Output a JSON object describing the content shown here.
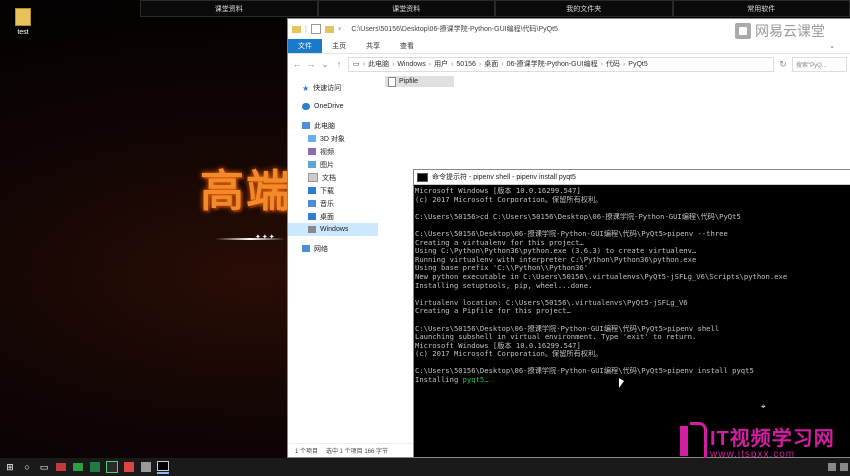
{
  "desktop": {
    "topbar": [
      "课堂资料",
      "课堂资料",
      "我的文件夹",
      "常用软件"
    ],
    "icon_label": "test",
    "bg_text": "高端",
    "bg_stars": "✦✦✦"
  },
  "explorer": {
    "title_path": "C:\\Users\\50156\\Desktop\\06-撩课学院-Python-GUI编程\\代码\\PyQt5",
    "logo_text": "网易云课堂",
    "ribbon_tabs": [
      "文件",
      "主页",
      "共享",
      "查看"
    ],
    "address_crumbs": [
      "此电脑",
      "Windows",
      "用户",
      "50156",
      "桌面",
      "06-撩课学院-Python-GUI编程",
      "代码",
      "PyQt5"
    ],
    "search_placeholder": "搜索\"PyQ...",
    "nav_items": [
      {
        "label": "快速访问",
        "icon": "star-icon"
      },
      {
        "label": "OneDrive",
        "icon": "cloud-icon"
      },
      {
        "label": "此电脑",
        "icon": "pc-icon"
      },
      {
        "label": "3D 对象",
        "icon": "cube-icon"
      },
      {
        "label": "视频",
        "icon": "video-icon"
      },
      {
        "label": "图片",
        "icon": "picture-icon"
      },
      {
        "label": "文档",
        "icon": "document-icon"
      },
      {
        "label": "下载",
        "icon": "download-icon"
      },
      {
        "label": "音乐",
        "icon": "music-icon"
      },
      {
        "label": "桌面",
        "icon": "desktop-icon"
      },
      {
        "label": "Windows",
        "icon": "drive-icon"
      },
      {
        "label": "网络",
        "icon": "network-icon"
      }
    ],
    "file_name": "Pipfile",
    "status_count": "1 个项目",
    "status_selected": "选中 1 个项目  166 字节"
  },
  "terminal": {
    "title": "命令提示符 - pipenv  shell - pipenv  install pyqt5",
    "lines": [
      {
        "t": "Microsoft Windows [版本 10.0.16299.547]",
        "h": ""
      },
      {
        "t": "(c) 2017 Microsoft Corporation。保留所有权利。",
        "h": ""
      },
      {
        "t": "",
        "h": ""
      },
      {
        "t": "C:\\Users\\50156>cd C:\\Users\\50156\\Desktop\\06-撩课学院-Python-GUI编程\\代码\\PyQt5",
        "h": ""
      },
      {
        "t": "",
        "h": ""
      },
      {
        "t": "C:\\Users\\50156\\Desktop\\06-撩课学院-Python-GUI编程\\代码\\PyQt5>pipenv --three",
        "h": ""
      },
      {
        "t": "Creating a virtualenv for this project…",
        "h": ""
      },
      {
        "t": "Using C:\\Python\\Python36\\python.exe (3.6.3) to create virtualenv…",
        "h": ""
      },
      {
        "t": "Running virtualenv with interpreter C:\\Python\\Python36\\python.exe",
        "h": ""
      },
      {
        "t": "Using base prefix 'C:\\\\Python\\\\Python36'",
        "h": ""
      },
      {
        "t": "New python executable in C:\\Users\\50156\\.virtualenvs\\PyQt5-jSFLg_V6\\Scripts\\python.exe",
        "h": ""
      },
      {
        "t": "Installing setuptools, pip, wheel...done.",
        "h": ""
      },
      {
        "t": "",
        "h": ""
      },
      {
        "t": "Virtualenv location: C:\\Users\\50156\\.virtualenvs\\PyQt5-jSFLg_V6",
        "h": ""
      },
      {
        "t": "Creating a Pipfile for this project…",
        "h": ""
      },
      {
        "t": "",
        "h": ""
      },
      {
        "t": "C:\\Users\\50156\\Desktop\\06-撩课学院-Python-GUI编程\\代码\\PyQt5>pipenv shell",
        "h": ""
      },
      {
        "t": "Launching subshell in virtual environment. Type 'exit' to return.",
        "h": ""
      },
      {
        "t": "Microsoft Windows [版本 10.0.16299.547]",
        "h": ""
      },
      {
        "t": "(c) 2017 Microsoft Corporation。保留所有权利。",
        "h": ""
      },
      {
        "t": "",
        "h": ""
      },
      {
        "t": "C:\\Users\\50156\\Desktop\\06-撩课学院-Python-GUI编程\\代码\\PyQt5>pipenv install pyqt5",
        "h": ""
      },
      {
        "t": "Installing ",
        "h": "pyqt5…"
      }
    ]
  },
  "watermark": {
    "line1": "IT视频学习网",
    "line2": "www.itspxx.com"
  },
  "taskbar": {
    "icons": [
      "windows-start-icon",
      "cortana-icon",
      "task-view-icon",
      "app-icon",
      "app-icon",
      "pycharm-icon",
      "app-icon",
      "app-icon",
      "app-icon",
      "cmd-icon"
    ]
  },
  "colors": {
    "ribbon_file": "#1979ca",
    "terminal_highlight": "#17c050",
    "watermark": "#d21ea0"
  }
}
